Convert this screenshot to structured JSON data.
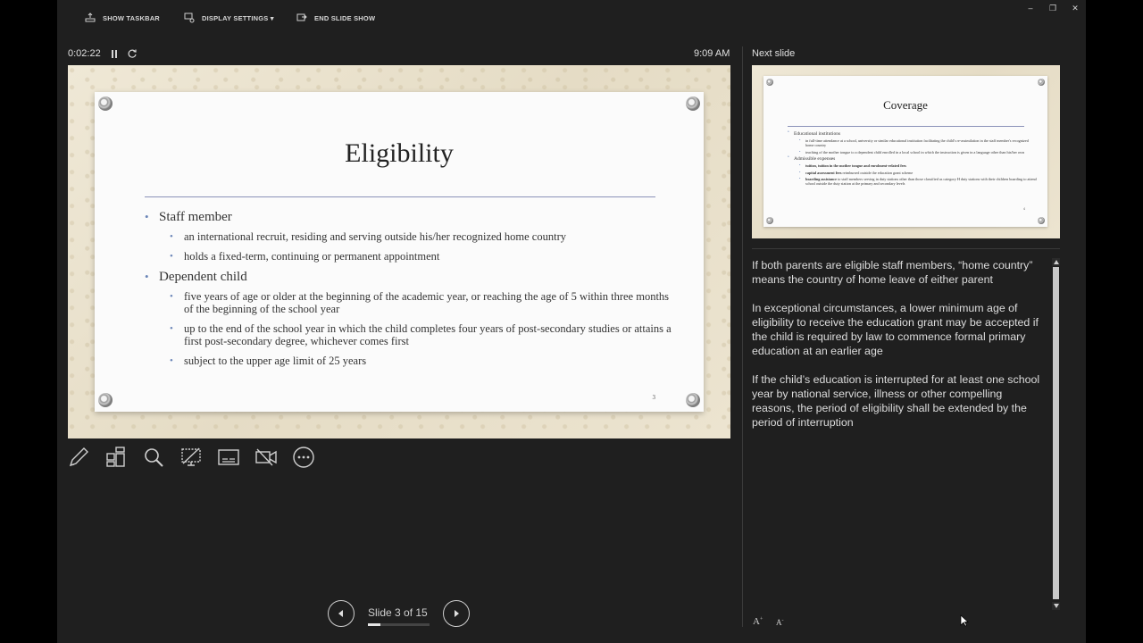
{
  "toolbar": {
    "show_taskbar": "SHOW TASKBAR",
    "display_settings": "DISPLAY SETTINGS ▾",
    "end_slide_show": "END SLIDE SHOW",
    "minimize": "–",
    "restore": "❐",
    "close": "✕"
  },
  "presenter": {
    "timer": "0:02:22",
    "clock": "9:09 AM"
  },
  "current_slide": {
    "title": "Eligibility",
    "number": "3",
    "bullets": [
      {
        "text": "Staff member",
        "sub": [
          "an international recruit, residing and serving outside his/her recognized home country",
          "holds a fixed-term, continuing or permanent appointment"
        ]
      },
      {
        "text": "Dependent child",
        "sub": [
          "five years of age or older at the beginning of the academic year, or reaching the age of 5 within three months of the beginning of the school year",
          "up to the end of the school year in which the child completes four years of post-secondary studies or attains a first post-secondary degree, whichever comes first",
          "subject to the upper age limit of 25 years"
        ]
      }
    ]
  },
  "tools": [
    "pen-tool",
    "see-all-slides",
    "zoom",
    "black-screen",
    "subtitles",
    "camera",
    "more-options"
  ],
  "navigation": {
    "counter": "Slide 3 of 15",
    "progress_fraction": 0.2
  },
  "next_slide": {
    "label": "Next slide",
    "title": "Coverage",
    "number": "4",
    "bullets": [
      {
        "text": "Educational institutions",
        "sub": [
          {
            "bold": "",
            "rest": "in full-time attendance at a school, university or similar educational institution facilitating the child's re-assimilation in the staff member's recognized home country"
          },
          {
            "bold": "",
            "rest": "teaching of the mother tongue to a dependent child enrolled in a local school in which the instruction is given in a language other than his/her own"
          }
        ]
      },
      {
        "text": "Admissible expenses",
        "sub": [
          {
            "bold": "tuition, tuition in the mother tongue and enrolment-related fees",
            "rest": ""
          },
          {
            "bold": "capital assessment fees",
            "rest": " reimbursed outside the education grant scheme"
          },
          {
            "bold": "boarding assistance",
            "rest": " to staff members serving in duty stations other than those classified as category H duty stations with their children boarding to attend school outside the duty station at the primary and secondary levels"
          }
        ]
      }
    ]
  },
  "notes": [
    "If both parents are eligible staff members, “home country” means the country of home leave of either parent",
    "In exceptional circumstances, a lower minimum age of eligibility to receive the education grant may be accepted if the child is required by law to commence formal primary education at an earlier age",
    "If the child’s education is interrupted for at least one school year by national service, illness or other compelling reasons, the period of eligibility shall be extended by the period of interruption"
  ],
  "font_controls": {
    "increase": "A",
    "decrease": "A"
  },
  "colors": {
    "background": "#1f1f1f",
    "bullet": "#6b86b8",
    "title_rule": "#8a91b8"
  }
}
